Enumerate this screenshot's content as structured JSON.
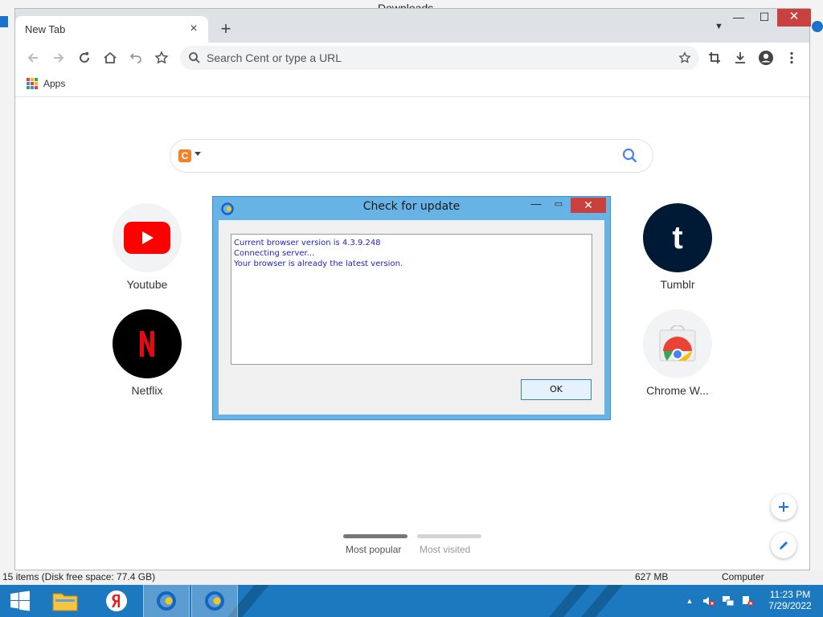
{
  "background": {
    "window_title": "Downloads",
    "status_items": "15 items (Disk free space: 77.4 GB)",
    "status_size": "627 MB",
    "status_location": "Computer"
  },
  "browser": {
    "tab": {
      "title": "New Tab",
      "close": "×"
    },
    "new_tab": "+",
    "omnibox": {
      "placeholder": "Search Cent or type a URL"
    },
    "bookmarks": {
      "apps_label": "Apps"
    },
    "ntp": {
      "engine_letter": "C",
      "tiles": [
        {
          "label": "Youtube"
        },
        {
          "label": "Netflix"
        },
        {
          "label": "Tumblr"
        },
        {
          "label": "Chrome W..."
        }
      ],
      "tabs": [
        {
          "label": "Most popular",
          "color": "#777777",
          "active": true
        },
        {
          "label": "Most visited",
          "color": "#d4d4d4",
          "active": false
        }
      ]
    }
  },
  "dialog": {
    "title": "Check for update",
    "lines": [
      "Current browser version is 4.3.9.248",
      "Connecting server...",
      "Your browser is already the latest version."
    ],
    "ok_label": "OK"
  },
  "taskbar": {
    "time": "11:23 PM",
    "date": "7/29/2022"
  },
  "colors": {
    "accent": "#1a73e8",
    "taskbar": "#1c78bf",
    "dialog_frame": "#68b3e6",
    "dialog_text": "#1f1ec2",
    "close_red": "#c9403c"
  }
}
